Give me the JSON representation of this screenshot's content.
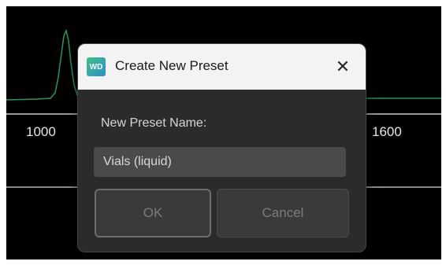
{
  "background": {
    "axis_ticks": [
      "1000",
      "1600"
    ],
    "trace_color": "#1d9a5a"
  },
  "dialog": {
    "title": "Create New Preset",
    "app_icon_text": "WD",
    "close_glyph": "✕",
    "field_label": "New Preset Name:",
    "name_value": "Vials (liquid)",
    "ok_label": "OK",
    "cancel_label": "Cancel"
  }
}
